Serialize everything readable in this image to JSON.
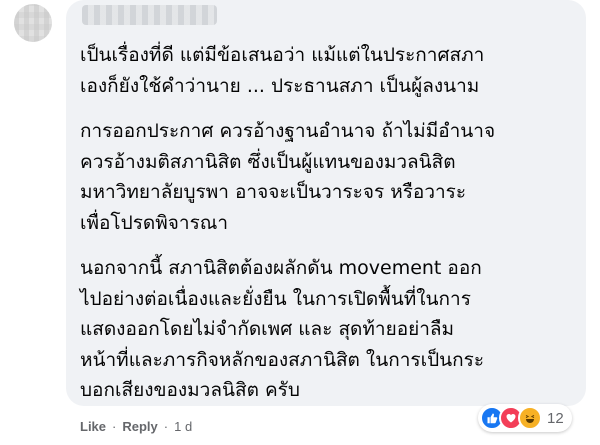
{
  "comment": {
    "author_name": "█████ ████",
    "paragraphs": [
      "เป็นเรื่องที่ดี แต่มีข้อเสนอว่า แม้แต่ในประกาศสภา\nเองก็ยังใช้คำว่านาย ... ประธานสภา เป็นผู้ลงนาม",
      "การออกประกาศ ควรอ้างฐานอำนาจ ถ้าไม่มีอำนาจ\nควรอ้างมติสภานิสิต ซึ่งเป็นผู้แทนของมวลนิสิต\nมหาวิทยาลัยบูรพา อาจจะเป็นวาระจร หรือวาระ\nเพื่อโปรดพิจารณา",
      "นอกจากนี้ สภานิสิตต้องผลักดัน movement ออก\nไปอย่างต่อเนื่องและยั่งยืน ในการเปิดพื้นที่ในการ\nแสดงออกโดยไม่จำกัดเพศ และ สุดท้ายอย่าลืม\nหน้าที่และภารกิจหลักของสภานิสิต ในการเป็นกระ\nบอกเสียงของมวลนิสิต ครับ"
    ],
    "reactions": {
      "icons": [
        "like-icon",
        "love-icon",
        "haha-icon"
      ],
      "count": "12"
    },
    "actions": {
      "like_label": "Like",
      "reply_label": "Reply",
      "separator": "·",
      "timestamp": "1 d"
    }
  },
  "colors": {
    "bubble_bg": "#f0f2f5",
    "text": "#050505",
    "meta_text": "#65676b",
    "like_blue": "#1877f2",
    "love_red": "#f33e58",
    "haha_yellow": "#f7b125"
  }
}
